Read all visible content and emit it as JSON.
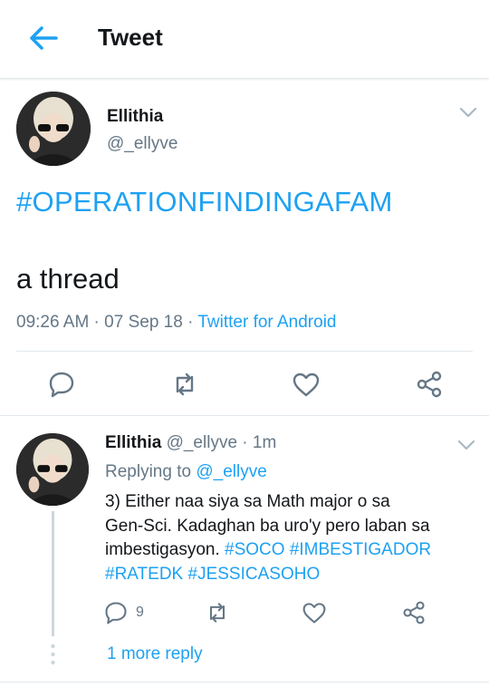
{
  "header": {
    "title": "Tweet"
  },
  "tweet": {
    "name": "Ellithia",
    "handle": "@_ellyve",
    "hashtag": "#OPERATIONFINDINGAFAM",
    "body": "a thread",
    "time": "09:26 AM",
    "sep1": " · ",
    "date": "07 Sep 18",
    "sep2": " · ",
    "source": "Twitter for Android"
  },
  "reply": {
    "name": "Ellithia",
    "handle": "@_ellyve",
    "sep": " · ",
    "time": "1m",
    "replying_prefix": "Replying to ",
    "replying_to": "@_ellyve",
    "text_line1": "3) Either naa siya sa Math major o sa",
    "text_line2": "Gen-Sci. Kadaghan ba uro'y pero laban sa",
    "text_line3": "imbestigasyon. ",
    "tags_line3": [
      "#SOCO",
      "#IMBESTIGADOR"
    ],
    "tags_line4": [
      "#RATEDK",
      "#JESSICASOHO"
    ],
    "reply_count": "9",
    "more_replies": "1 more reply"
  },
  "colors": {
    "accent": "#1da1f2",
    "muted": "#657786",
    "text": "#14171a",
    "divider": "#e1e8ed"
  },
  "icons": [
    "back-arrow-icon",
    "chevron-down-icon",
    "reply-icon",
    "retweet-icon",
    "like-icon",
    "share-icon"
  ]
}
